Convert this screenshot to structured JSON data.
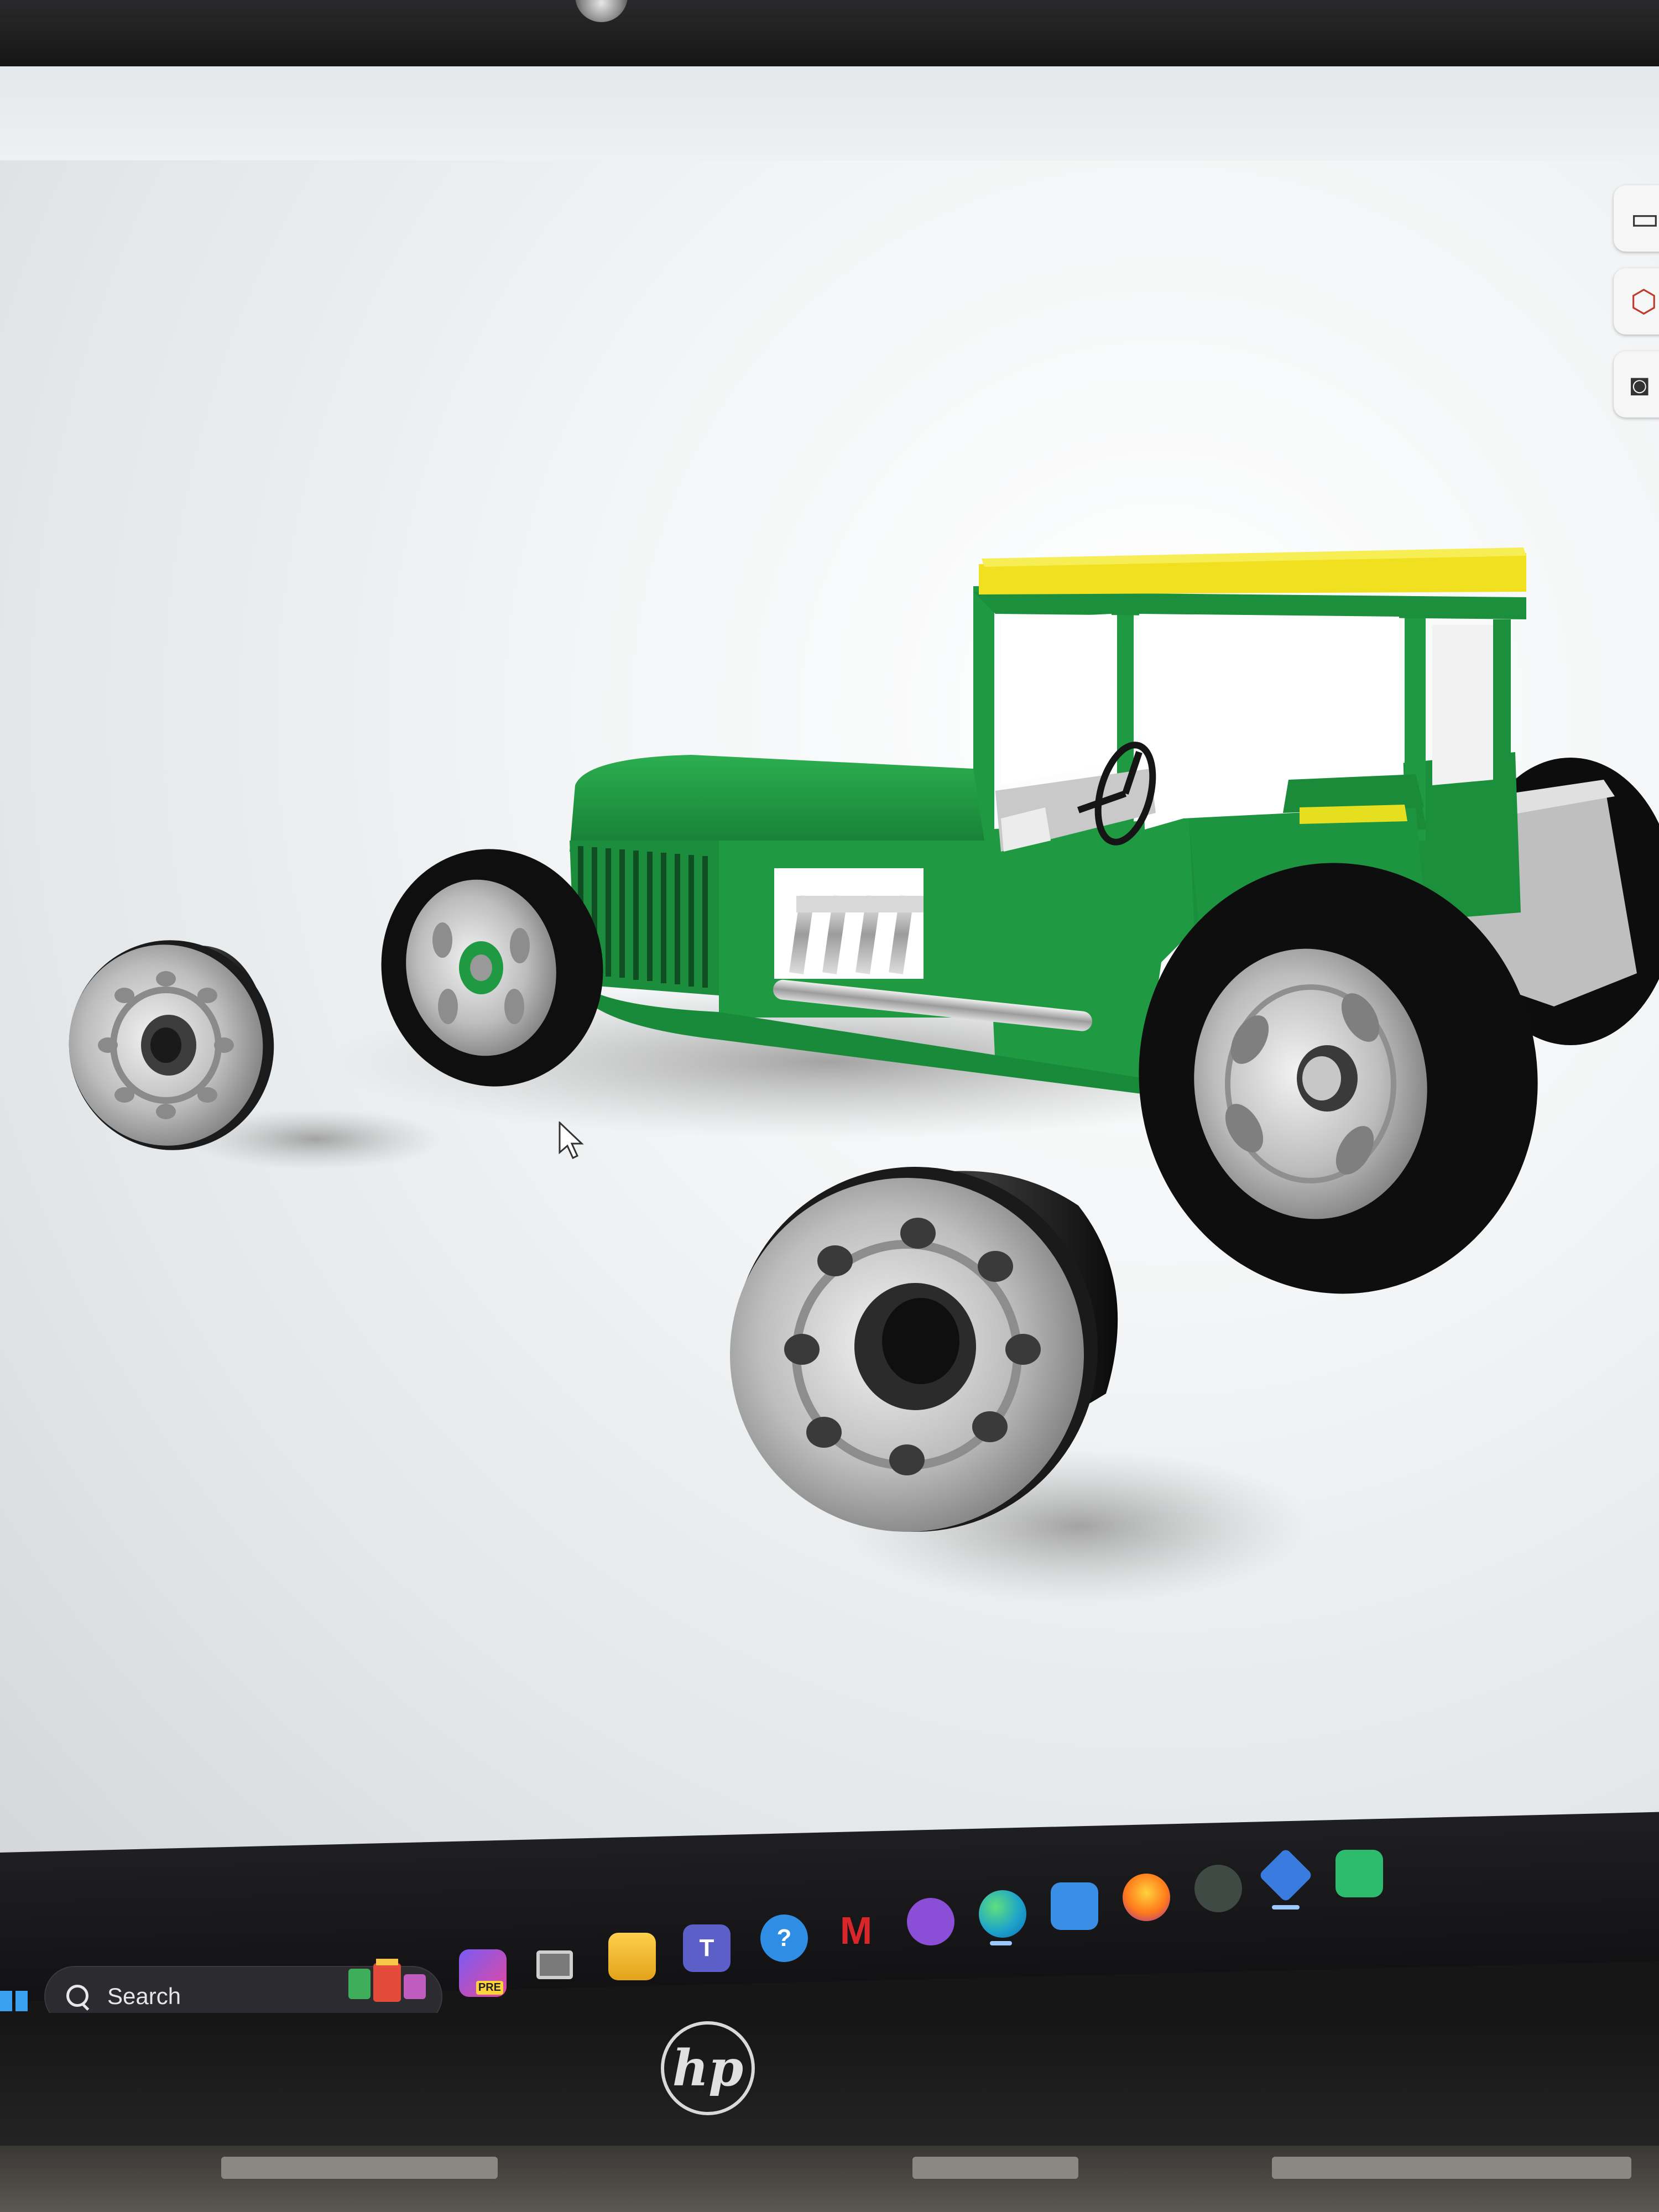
{
  "taskbar": {
    "search": {
      "label": "Search"
    },
    "apps": [
      {
        "name": "copilot",
        "badge": "PRE",
        "color": "#7a5af5"
      },
      {
        "name": "task-view",
        "color": "#d0d0d0"
      },
      {
        "name": "file-explorer",
        "color": "#f2b632"
      },
      {
        "name": "teams",
        "badge": "T",
        "color": "#5b5fc7"
      },
      {
        "name": "get-help",
        "badge": "?",
        "color": "#2f8de4"
      },
      {
        "name": "mcafee",
        "badge": "M",
        "color": "#d8262a"
      },
      {
        "name": "social-app",
        "color": "#8a4fd6"
      },
      {
        "name": "edge",
        "color": "#1fa4c9"
      },
      {
        "name": "microsoft-store",
        "color": "#3a8ee6"
      },
      {
        "name": "firefox",
        "color": "#ff7a1a"
      },
      {
        "name": "app-dark",
        "color": "#404a44"
      },
      {
        "name": "3d-app",
        "color": "#3a7be0"
      },
      {
        "name": "app-green",
        "color": "#2dbb6e"
      }
    ]
  },
  "viewport_tools": [
    {
      "name": "panel-toggle",
      "icon": "panel-icon"
    },
    {
      "name": "view-cube",
      "icon": "view-cube-icon"
    },
    {
      "name": "camera",
      "icon": "camera-icon"
    }
  ],
  "scene": {
    "body_color": "#1f9a42",
    "roof_color": "#f0e020",
    "tire_color": "#111111",
    "rim_color": "#c8c8c8"
  },
  "laptop": {
    "logo": "hp"
  }
}
